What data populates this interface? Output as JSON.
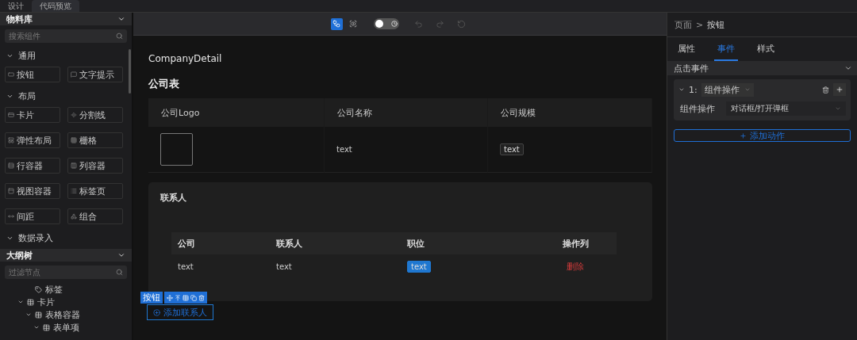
{
  "top_tabs": [
    {
      "label": "设计",
      "selected": false
    },
    {
      "label": "代码预览",
      "selected": true
    }
  ],
  "material_panel": {
    "title": "物料库",
    "search": {
      "placeholder": "搜索组件"
    },
    "groups": [
      {
        "title": "通用",
        "expanded": true,
        "items": [
          "按钮",
          "文字提示"
        ]
      },
      {
        "title": "布局",
        "expanded": true,
        "items": [
          "卡片",
          "分割线",
          "弹性布局",
          "栅格",
          "行容器",
          "列容器",
          "视图容器",
          "标签页",
          "间距",
          "组合"
        ]
      },
      {
        "title": "数据录入",
        "expanded": true
      }
    ]
  },
  "outline_panel": {
    "title": "大纲树",
    "search": {
      "placeholder": "过滤节点"
    },
    "tree": [
      {
        "children": [
          {
            "label": "标签"
          }
        ]
      },
      {
        "label": "卡片",
        "expanded": true,
        "children": [
          {
            "label": "表格容器",
            "expanded": true,
            "children": [
              {
                "label": "表单项",
                "expanded": true
              }
            ]
          }
        ]
      }
    ]
  },
  "toolbar": {
    "tools": [
      {
        "selected": true
      },
      {
        "selected": false
      }
    ],
    "toggle": {
      "on": false
    },
    "history_disabled": true
  },
  "canvas": {
    "page_title": "CompanyDetail",
    "company_table": {
      "title": "公司表",
      "columns": [
        "公司Logo",
        "公司名称",
        "公司规模"
      ],
      "rows": [
        {
          "name": "text",
          "scale": "text"
        }
      ]
    },
    "contacts_card": {
      "title": "联系人",
      "columns": [
        "公司",
        "联系人",
        "职位",
        "操作列"
      ],
      "rows": [
        {
          "company": "text",
          "contact": "text",
          "position": "text",
          "action": "删除"
        }
      ]
    },
    "selection_label": "按钮",
    "add_button": "添加联系人"
  },
  "settings_panel": {
    "breadcrumb": [
      "页面",
      "按钮"
    ],
    "breadcrumb_separator": ">",
    "tabs": [
      {
        "label": "属性",
        "selected": false
      },
      {
        "label": "事件",
        "selected": true
      },
      {
        "label": "样式",
        "selected": false
      }
    ],
    "event": {
      "title": "点击事件",
      "expanded": true,
      "actions": [
        {
          "index": "1:",
          "name": "组件操作",
          "expanded": true,
          "field_label": "组件操作",
          "field_value": "对话框/打开弹框"
        }
      ]
    },
    "add_action": "添加动作"
  }
}
